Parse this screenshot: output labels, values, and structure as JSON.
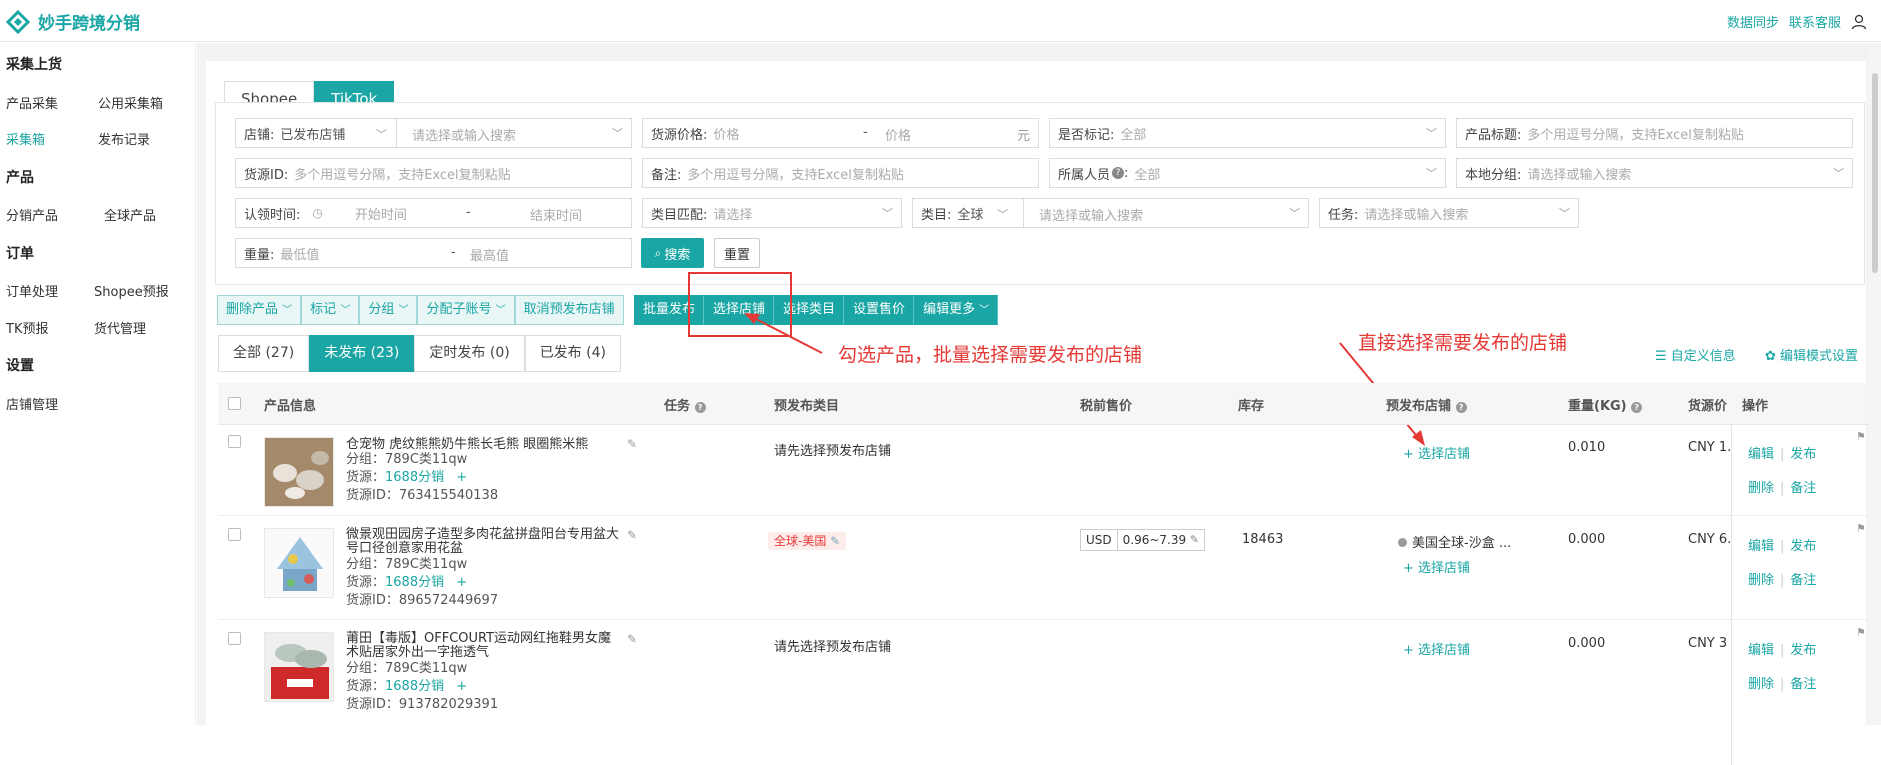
{
  "app": {
    "brand": "妙手跨境分销",
    "top_links": [
      "数据同步",
      "联系客服"
    ]
  },
  "sidebar": {
    "groups": [
      {
        "title": "采集上货",
        "items": [
          "产品采集",
          "公用采集箱",
          "采集箱",
          "发布记录"
        ]
      },
      {
        "title": "产品",
        "items": [
          "分销产品",
          "全球产品"
        ]
      },
      {
        "title": "订单",
        "items": [
          "订单处理",
          "Shopee预报",
          "TK预报",
          "货代管理"
        ]
      },
      {
        "title": "设置",
        "items": [
          "店铺管理"
        ]
      }
    ],
    "active": "采集箱"
  },
  "platform_tabs": [
    "Shopee",
    "TikTok"
  ],
  "filters": {
    "shop_label": "店铺:",
    "shop_value": "已发布店铺",
    "shop_placeholder": "请选择或输入搜索",
    "price_label": "货源价格:",
    "price_min": "价格",
    "price_dash": "-",
    "price_max": "价格",
    "price_unit": "元",
    "marked_label": "是否标记:",
    "marked_value": "全部",
    "title_label": "产品标题:",
    "title_placeholder": "多个用逗号分隔，支持Excel复制粘贴",
    "srcid_label": "货源ID:",
    "srcid_placeholder": "多个用逗号分隔，支持Excel复制粘贴",
    "note_label": "备注:",
    "note_placeholder": "多个用逗号分隔，支持Excel复制粘贴",
    "owner_label": "所属人员",
    "owner_value": "全部",
    "group_label": "本地分组:",
    "group_placeholder": "请选择或输入搜索",
    "claim_label": "认领时间:",
    "claim_start": "开始时间",
    "claim_dash": "-",
    "claim_end": "结束时间",
    "catmatch_label": "类目匹配:",
    "catmatch_placeholder": "请选择",
    "cat_label": "类目:",
    "cat_value": "全球",
    "cat_placeholder": "请选择或输入搜索",
    "task_label": "任务:",
    "task_placeholder": "请选择或输入搜索",
    "weight_label": "重量:",
    "weight_min": "最低值",
    "weight_dash": "-",
    "weight_max": "最高值",
    "search_btn": "搜索",
    "reset_btn": "重置"
  },
  "action_bar": {
    "light": [
      "删除产品",
      "标记",
      "分组",
      "分配子账号",
      "取消预发布店铺"
    ],
    "solid": [
      "批量发布",
      "选择店铺",
      "选择类目",
      "设置售价",
      "编辑更多"
    ]
  },
  "status_tabs": [
    "全部 (27)",
    "未发布 (23)",
    "定时发布 (0)",
    "已发布 (4)"
  ],
  "right_tools": [
    "自定义信息",
    "编辑模式设置"
  ],
  "annotations": {
    "a1": "勾选产品，批量选择需要发布的店铺",
    "a2": "直接选择需要发布的店铺"
  },
  "table": {
    "headers": [
      "产品信息",
      "任务",
      "预发布类目",
      "税前售价",
      "库存",
      "预发布店铺",
      "重量(KG)",
      "货源价",
      "操作"
    ],
    "rows": [
      {
        "title": "仓宠物 虎纹熊熊奶牛熊长毛熊 眼圈熊米熊",
        "group": "分组：789C类11qw",
        "source_prefix": "货源：",
        "source": "1688分销",
        "add": "+",
        "srcid": "货源ID：763415540138",
        "category": "请先选择预发布店铺",
        "price": "",
        "stock": "",
        "shop_name": "",
        "select_shop": "+ 选择店铺",
        "weight": "0.010",
        "src_price": "CNY 1.",
        "ops": [
          "编辑",
          "发布",
          "删除",
          "备注"
        ]
      },
      {
        "title": "微景观田园房子造型多肉花盆拼盘阳台专用盆大号口径创意家用花盆",
        "group": "分组：789C类11qw",
        "source_prefix": "货源：",
        "source": "1688分销",
        "add": "+",
        "srcid": "货源ID：896572449697",
        "category": "全球-美国",
        "price_cur": "USD",
        "price": "0.96~7.39",
        "stock": "18463",
        "shop_name": "美国全球-沙盒 ...",
        "select_shop": "+ 选择店铺",
        "weight": "0.000",
        "src_price": "CNY 6.",
        "ops": [
          "编辑",
          "发布",
          "删除",
          "备注"
        ]
      },
      {
        "title": "莆田【毒版】OFFCOURT运动网红拖鞋男女魔术贴居家外出一字拖透气",
        "group": "分组：789C类11qw",
        "source_prefix": "货源：",
        "source": "1688分销",
        "add": "+",
        "srcid": "货源ID：913782029391",
        "category": "请先选择预发布店铺",
        "price": "",
        "stock": "",
        "shop_name": "",
        "select_shop": "+ 选择店铺",
        "weight": "0.000",
        "src_price": "CNY 3",
        "ops": [
          "编辑",
          "发布",
          "删除",
          "备注"
        ]
      }
    ]
  }
}
